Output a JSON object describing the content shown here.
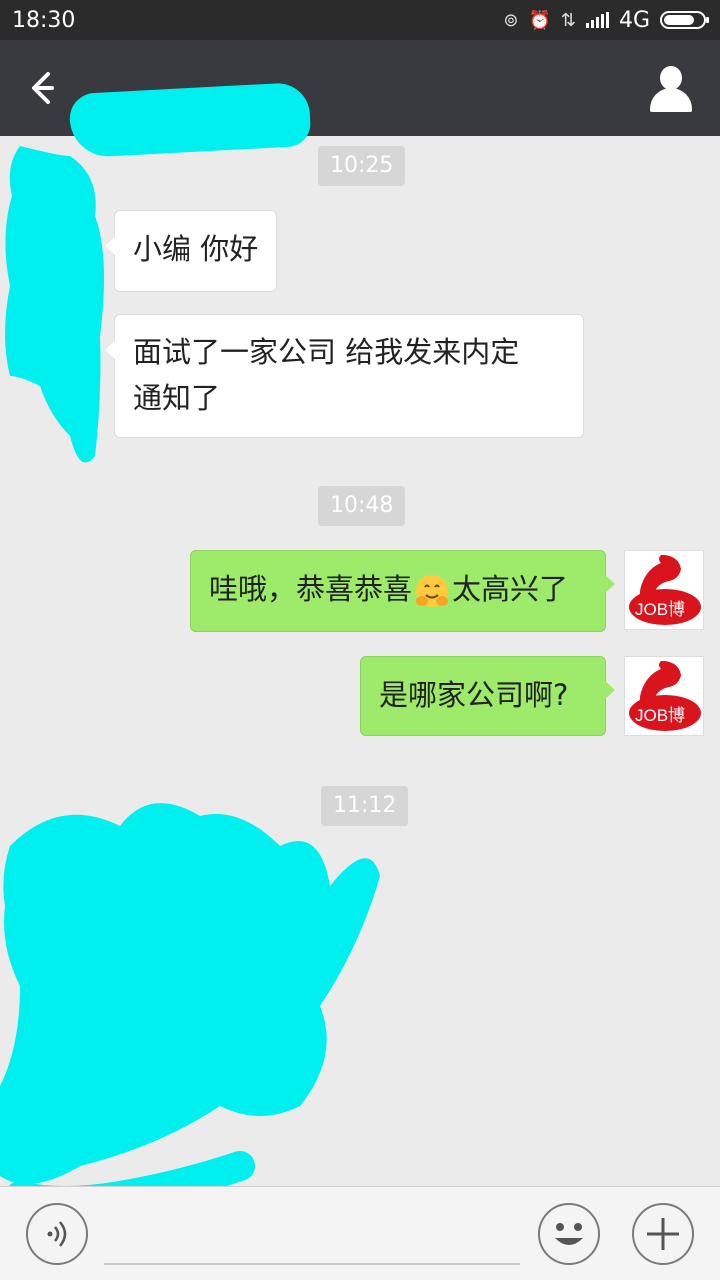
{
  "status_bar": {
    "time": "18:30",
    "network": "4G"
  },
  "header": {
    "back_icon": "back-arrow-icon",
    "contact_name": "",
    "profile_icon": "person-icon"
  },
  "messages": [
    {
      "type": "time",
      "text": "10:25"
    },
    {
      "type": "received",
      "text": "小编 你好"
    },
    {
      "type": "received",
      "text_line1": "面试了一家公司 给我发来内定",
      "text_line2": "通知了"
    },
    {
      "type": "time",
      "text": "10:48"
    },
    {
      "type": "sent",
      "text_before": "哇哦，恭喜恭喜",
      "emoji": "hugging-face-icon",
      "text_after": "太高兴了",
      "avatar_text": "JOB博"
    },
    {
      "type": "sent",
      "text": "是哪家公司啊?",
      "avatar_text": "JOB博"
    },
    {
      "type": "time",
      "text": "11:12"
    }
  ],
  "input_bar": {
    "voice_icon": "voice-icon",
    "emoji_icon": "smiley-icon",
    "plus_icon": "plus-icon"
  },
  "colors": {
    "sent_bubble": "#9eea6a",
    "header_bg": "#393a3f",
    "redaction": "#00f0f0",
    "avatar_red": "#d9141d"
  }
}
